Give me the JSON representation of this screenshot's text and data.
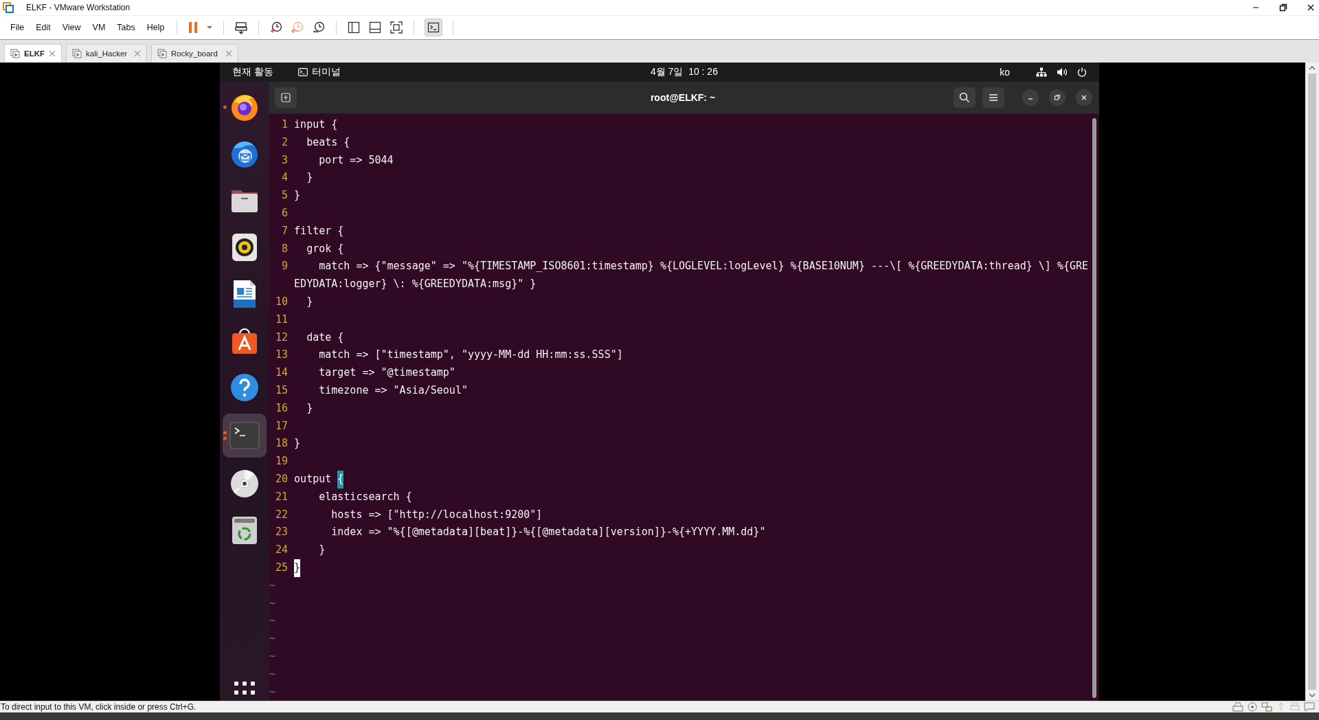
{
  "window": {
    "title": "ELKF - VMware Workstation"
  },
  "menu": [
    "File",
    "Edit",
    "View",
    "VM",
    "Tabs",
    "Help"
  ],
  "toolbar": {
    "console_view": {
      "on": true
    }
  },
  "tabs": [
    {
      "label": "ELKF",
      "selected": true
    },
    {
      "label": "kali_Hacker",
      "selected": false
    },
    {
      "label": "Rocky_board",
      "selected": false
    }
  ],
  "guest": {
    "top_bar": {
      "activities": "현재 활동",
      "app": "터미널",
      "clock": "4월 7일  10 : 26",
      "input_method": "ko"
    },
    "dock": {
      "items": [
        {
          "kind": "browser",
          "active": false,
          "running": true,
          "multiple_windows": false
        },
        {
          "kind": "mail",
          "active": false,
          "running": false,
          "multiple_windows": false
        },
        {
          "kind": "files",
          "active": false,
          "running": false,
          "multiple_windows": false
        },
        {
          "kind": "music",
          "active": false,
          "running": false,
          "multiple_windows": false
        },
        {
          "kind": "document",
          "active": false,
          "running": false,
          "multiple_windows": false
        },
        {
          "kind": "store",
          "active": false,
          "running": false,
          "multiple_windows": false
        },
        {
          "kind": "help",
          "active": false,
          "running": false,
          "multiple_windows": false
        },
        {
          "kind": "terminal",
          "active": true,
          "running": true,
          "multiple_windows": true
        },
        {
          "kind": "disc",
          "active": false,
          "running": false,
          "multiple_windows": false
        },
        {
          "kind": "trash",
          "active": false,
          "running": false,
          "multiple_windows": false
        }
      ]
    }
  },
  "terminal": {
    "title": "root@ELKF: ~",
    "lines": [
      {
        "number": "1",
        "text": "input {"
      },
      {
        "number": "2",
        "text": "  beats {"
      },
      {
        "number": "3",
        "text": "    port => 5044"
      },
      {
        "number": "4",
        "text": "  }"
      },
      {
        "number": "5",
        "text": "}"
      },
      {
        "number": "6"
      },
      {
        "number": "7",
        "text": "filter {"
      },
      {
        "number": "8",
        "text": "  grok {"
      },
      {
        "number": "9",
        "text": "    match => {\"message\" => \"%{TIMESTAMP_ISO8601:timestamp} %{LOGLEVEL:logLevel} %{BASE10NUM} ---\\[ %{GREEDYDATA:thread} \\] %{GREEDYDATA:logger} \\: %{GREEDYDATA:msg}\" }"
      },
      {
        "number": "10",
        "text": "  }"
      },
      {
        "number": "11"
      },
      {
        "number": "12",
        "text": "  date {"
      },
      {
        "number": "13",
        "text": "    match => [\"timestamp\", \"yyyy-MM-dd HH:mm:ss.SSS\"]"
      },
      {
        "number": "14",
        "text": "    target => \"@timestamp\""
      },
      {
        "number": "15",
        "text": "    timezone => \"Asia/Seoul\""
      },
      {
        "number": "16",
        "text": "  }"
      },
      {
        "number": "17"
      },
      {
        "number": "18",
        "text": "}"
      },
      {
        "number": "19"
      },
      {
        "number": "20",
        "text": "output ",
        "highlight": {
          "char": "{",
          "kind": "match"
        }
      },
      {
        "number": "21",
        "text": "    elasticsearch {"
      },
      {
        "number": "22",
        "text": "      hosts => [\"http://localhost:9200\"]"
      },
      {
        "number": "23",
        "text": "      index => \"%{[@metadata][beat]}-%{[@metadata][version]}-%{+YYYY.MM.dd}\""
      },
      {
        "number": "24",
        "text": "    }"
      },
      {
        "number": "25",
        "highlight": {
          "char": "}",
          "kind": "cursor"
        }
      }
    ],
    "empty_rows": [
      "~",
      "~",
      "~",
      "~",
      "~",
      "~",
      "~"
    ]
  },
  "status_bar": {
    "text": "To direct input to this VM, click inside or press Ctrl+G."
  }
}
